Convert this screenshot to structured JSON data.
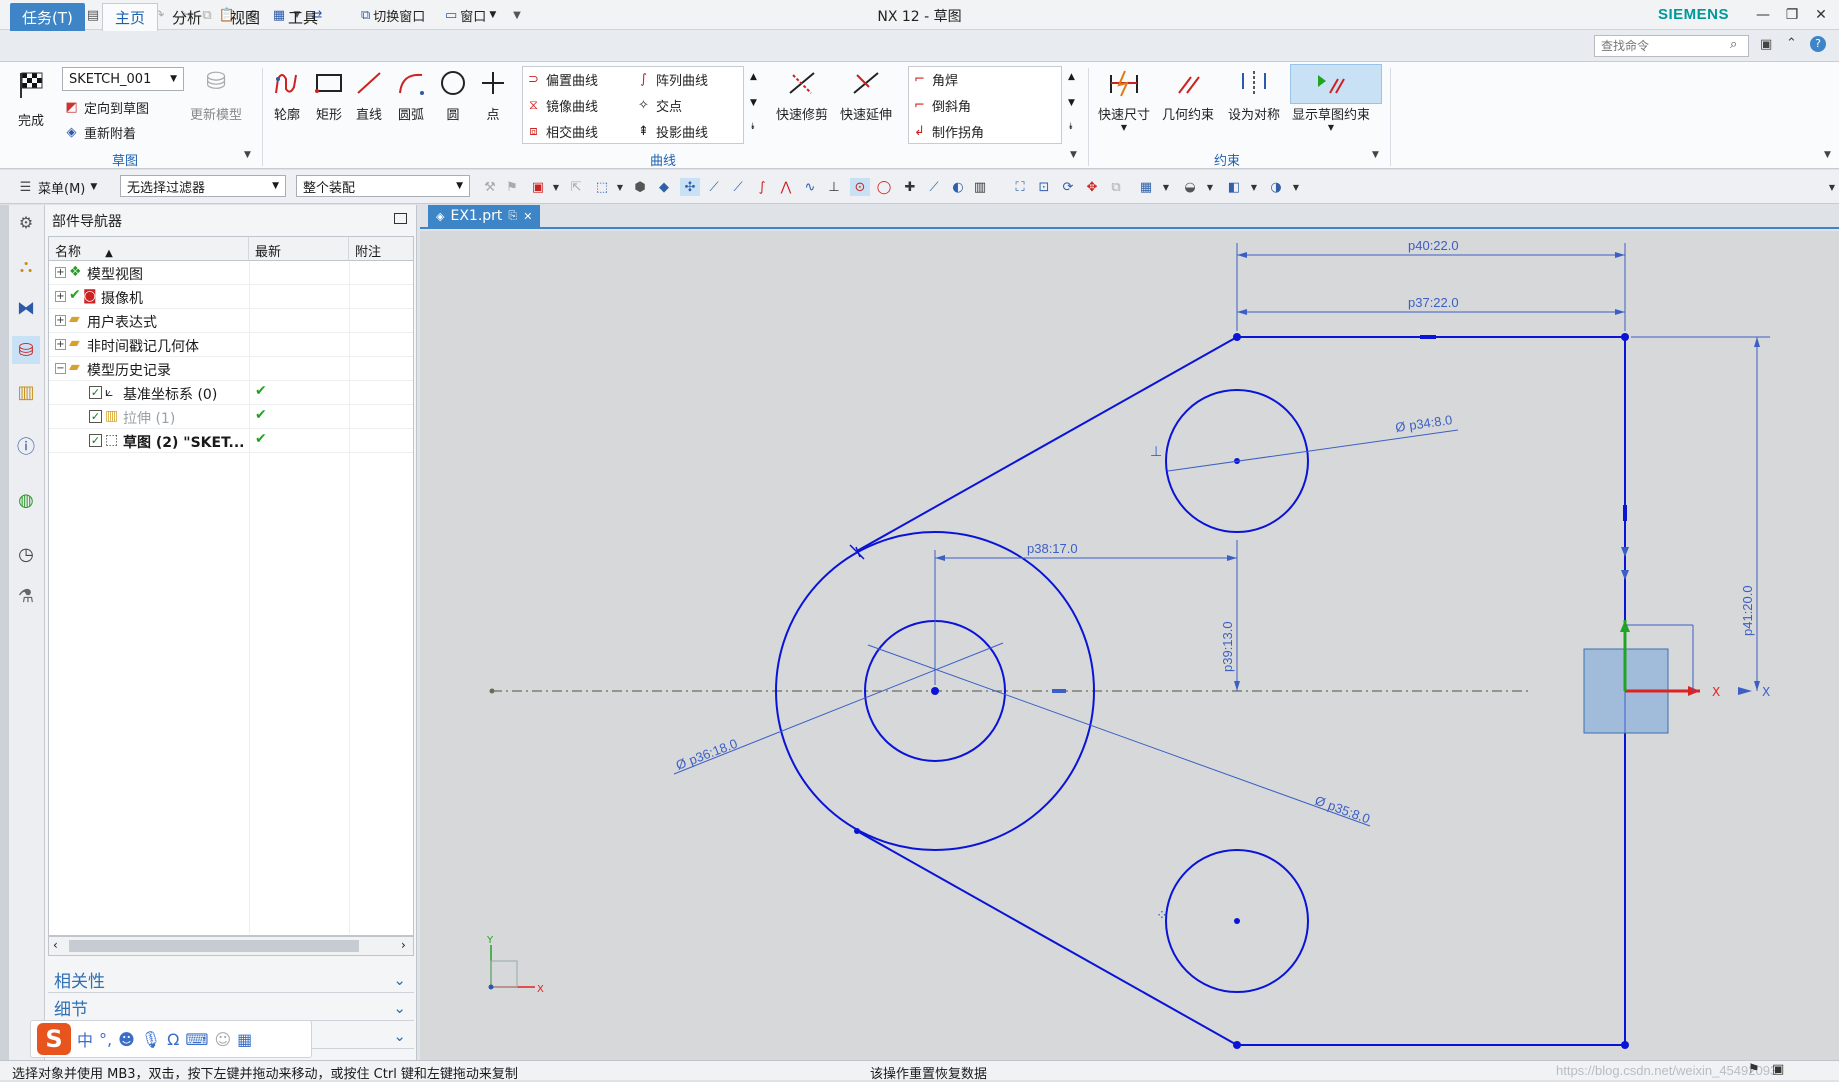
{
  "titlebar": {
    "logo": "NX",
    "title": "NX 12 - 草图",
    "brand": "SIEMENS",
    "switch_window": "切换窗口",
    "window_menu": "窗口"
  },
  "tabs": {
    "task": "任务(T)",
    "home": "主页",
    "analysis": "分析",
    "view": "视图",
    "tools": "工具"
  },
  "search": {
    "placeholder": "查找命令"
  },
  "ribbon": {
    "sketch_group": {
      "label": "草图",
      "finish": "完成",
      "sketch_name": "SKETCH_001",
      "orient_to_sketch": "定向到草图",
      "reattach": "重新附着",
      "update_model": "更新模型"
    },
    "curve_group": {
      "label": "曲线",
      "profile": "轮廓",
      "rectangle": "矩形",
      "line": "直线",
      "arc": "圆弧",
      "circle": "圆",
      "point": "点",
      "offset_curve": "偏置曲线",
      "pattern_curve": "阵列曲线",
      "mirror_curve": "镜像曲线",
      "intersection_point": "交点",
      "intersection_curve": "相交曲线",
      "project_curve": "投影曲线",
      "quick_trim": "快速修剪",
      "quick_extend": "快速延伸",
      "fillet": "角焊",
      "chamfer": "倒斜角",
      "make_corner": "制作拐角"
    },
    "constraint_group": {
      "label": "约束",
      "rapid_dimension": "快速尺寸",
      "geometric_constraint": "几何约束",
      "make_symmetric": "设为对称",
      "show_constraints": "显示草图约束"
    }
  },
  "toolbar2": {
    "menu": "菜单(M)",
    "selection_filter": "无选择过滤器",
    "assembly_scope": "整个装配"
  },
  "navigator": {
    "title": "部件导航器",
    "columns": [
      "名称",
      "最新",
      "附注"
    ],
    "rows": [
      {
        "label": "模型视图",
        "latest": ""
      },
      {
        "label": "摄像机",
        "latest": ""
      },
      {
        "label": "用户表达式",
        "latest": ""
      },
      {
        "label": "非时间戳记几何体",
        "latest": ""
      },
      {
        "label": "模型历史记录",
        "latest": ""
      },
      {
        "label": "基准坐标系 (0)",
        "latest": "✔"
      },
      {
        "label": "拉伸 (1)",
        "latest": "✔"
      },
      {
        "label": "草图 (2) \"SKET...",
        "latest": "✔"
      }
    ],
    "sections": [
      "相关性",
      "细节",
      ""
    ]
  },
  "document": {
    "tab": "EX1.prt"
  },
  "sketch": {
    "dimensions": {
      "p40": "p40:22.0",
      "p37": "p37:22.0",
      "p34": "p34:8.0",
      "p38": "p38:17.0",
      "p39": "p39:13.0",
      "p41": "p41:20.0",
      "p36": "p36:18.0",
      "p35": "p35:8.0"
    },
    "axis_x": "X",
    "axis_y": "Y",
    "diameter_symbol": "Ø"
  },
  "status": {
    "left": "选择对象并使用 MB3，双击，按下左键并拖动来移动，或按住 Ctrl 键和左键拖动来复制",
    "center": "该操作重置恢复数据",
    "watermark": "https://blog.csdn.net/weixin_45492093"
  },
  "ime": {
    "mode": "中"
  },
  "colors": {
    "sketch_blue": "#0a14d6",
    "dim_blue": "#3c5fc4",
    "accent": "#3d85c6",
    "brand": "#009999",
    "check_green": "#22a322"
  }
}
